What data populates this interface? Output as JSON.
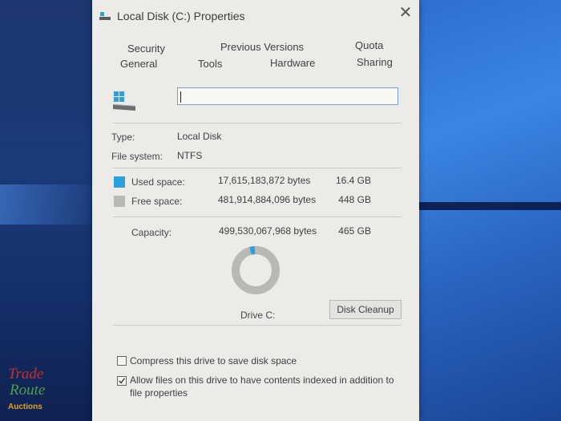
{
  "dialog": {
    "title": "Local Disk (C:) Properties",
    "close_symbol": "✕"
  },
  "tabs": {
    "row1": [
      "Security",
      "Previous Versions",
      "Quota"
    ],
    "row2": [
      "General",
      "Tools",
      "Hardware",
      "Sharing"
    ]
  },
  "general": {
    "name_value": "",
    "type_label": "Type:",
    "type_value": "Local Disk",
    "fs_label": "File system:",
    "fs_value": "NTFS",
    "used_label": "Used space:",
    "used_bytes": "17,615,183,872 bytes",
    "used_gb": "16.4 GB",
    "free_label": "Free space:",
    "free_bytes": "481,914,884,096 bytes",
    "free_gb": "448 GB",
    "capacity_label": "Capacity:",
    "capacity_bytes": "499,530,067,968 bytes",
    "capacity_gb": "465 GB",
    "drive_label": "Drive C:",
    "cleanup_label": "Disk Cleanup",
    "used_fraction": 0.035
  },
  "options": {
    "compress_label": "Compress this drive to save disk space",
    "compress_checked": false,
    "index_label": "Allow files on this drive to have contents indexed in addition to file properties",
    "index_checked": true
  },
  "colors": {
    "used": "#2aa0dc",
    "free": "#b8b8b4"
  },
  "watermark": {
    "line1": "Trade",
    "line2": "Route",
    "line3": "Auctions"
  }
}
